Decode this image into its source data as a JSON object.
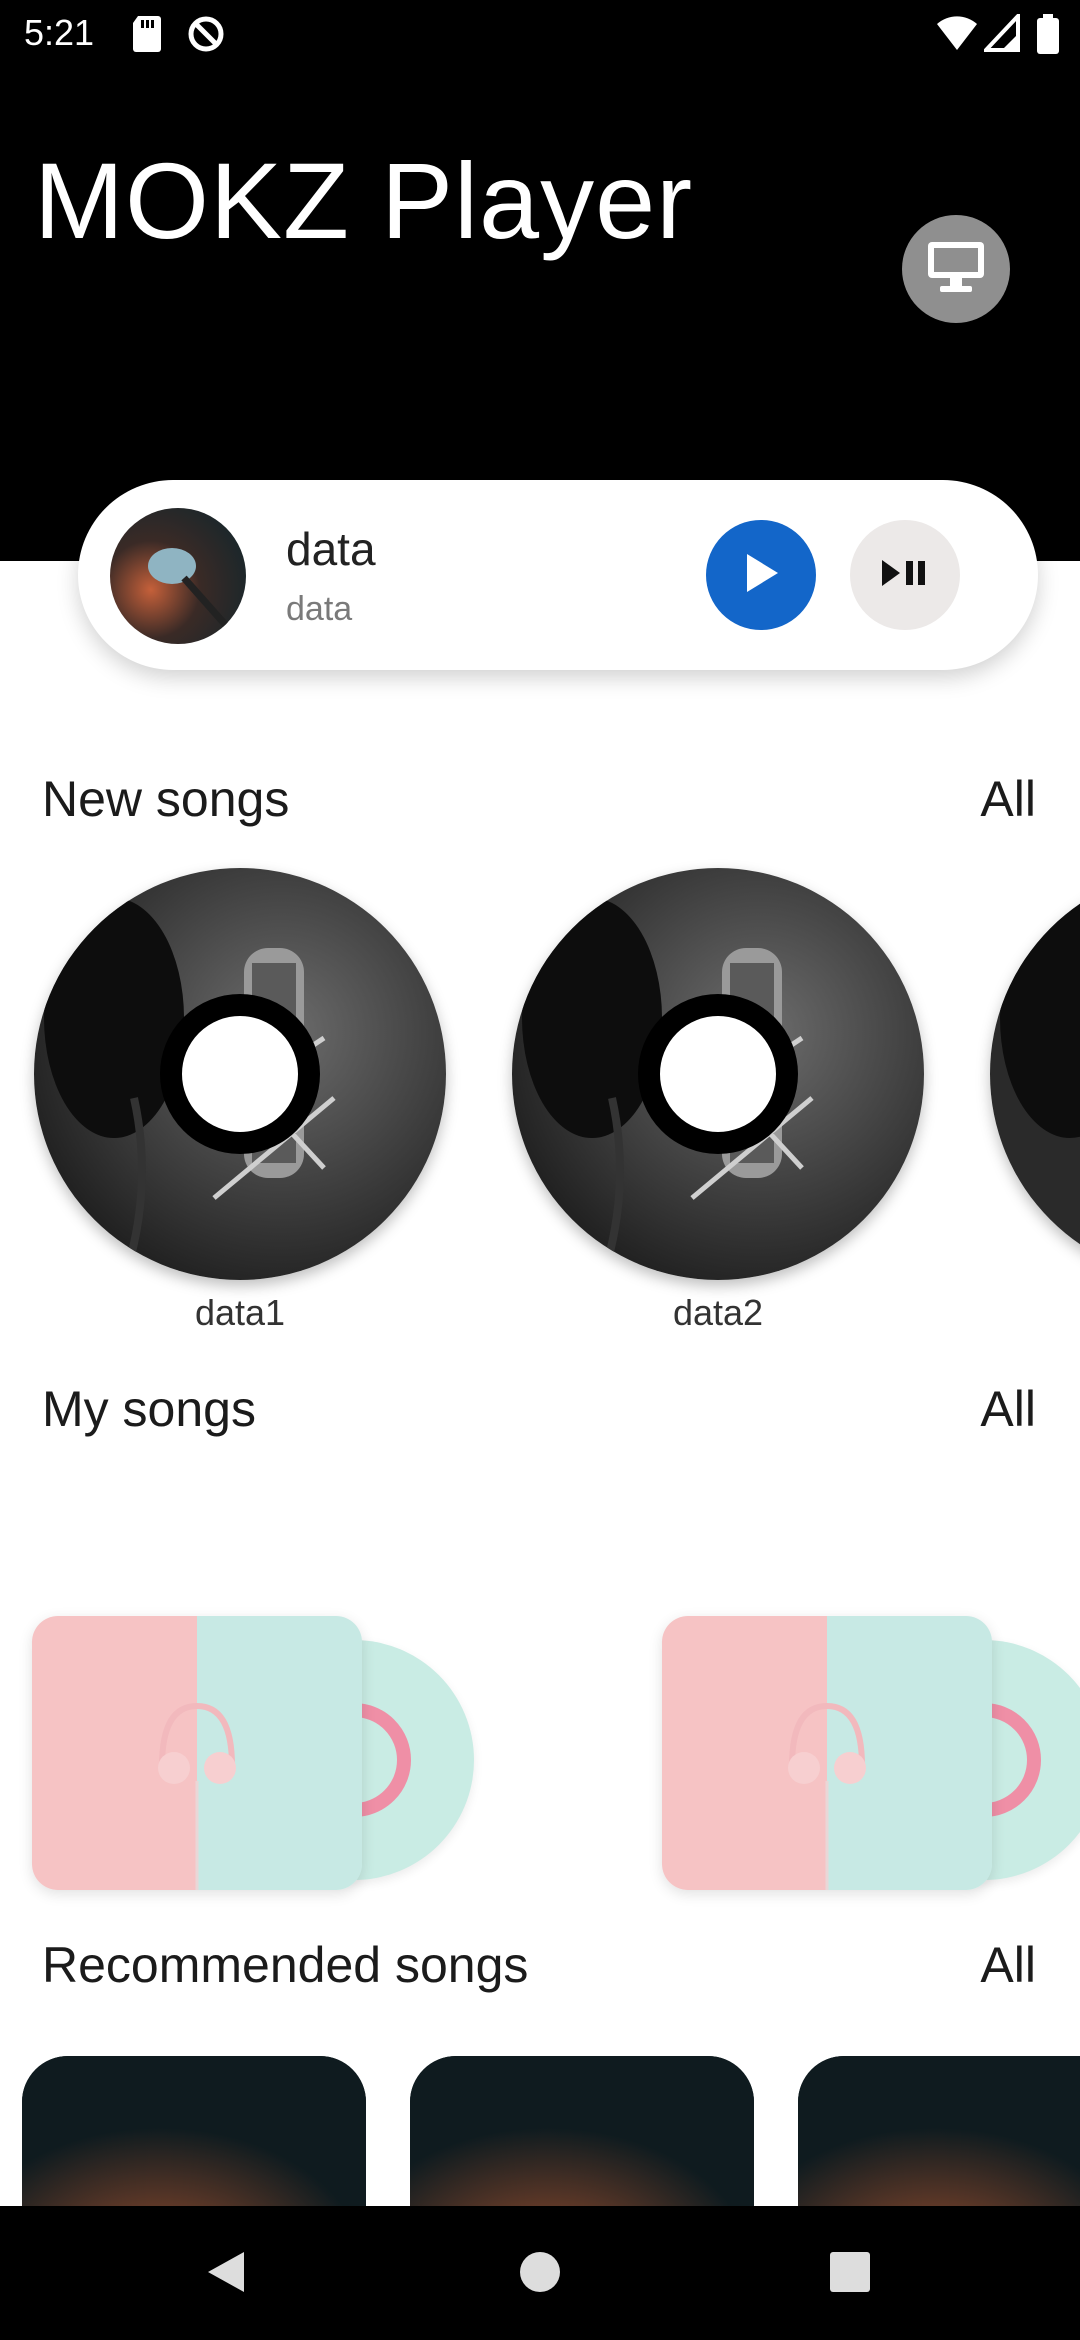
{
  "status_bar": {
    "time": "5:21"
  },
  "header": {
    "title": "MOKZ Player"
  },
  "now_playing": {
    "title": "data",
    "subtitle": "data"
  },
  "sections": {
    "new_songs": {
      "title": "New songs",
      "all": "All",
      "items": [
        "data1",
        "data2"
      ]
    },
    "my_songs": {
      "title": "My songs",
      "all": "All"
    },
    "recommended": {
      "title": "Recommended songs",
      "all": "All"
    }
  },
  "colors": {
    "accent": "#1366c9",
    "header_bg": "#000000",
    "cast_button_bg": "#8f8f8f"
  },
  "icons": [
    "sd-card-icon",
    "no-sync-icon",
    "wifi-icon",
    "signal-icon",
    "battery-icon",
    "monitor-icon",
    "play-icon",
    "play-pause-icon",
    "back-icon",
    "home-icon",
    "recents-icon"
  ]
}
